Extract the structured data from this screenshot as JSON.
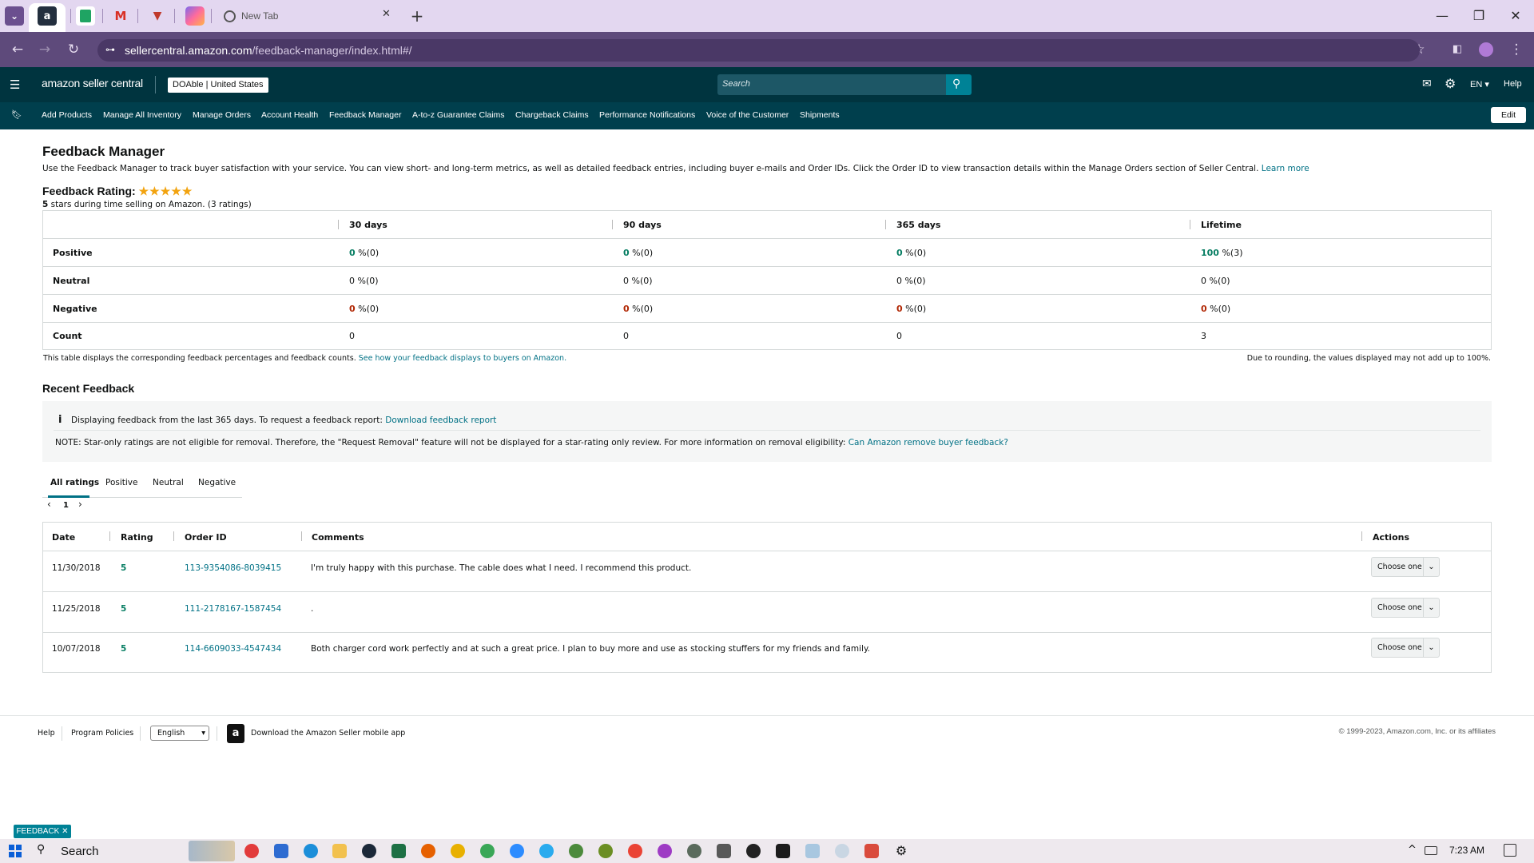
{
  "browser": {
    "tabs": [
      {
        "label": "",
        "icon": "amazon-icon"
      },
      {
        "label": "",
        "icon": "sheets-icon"
      },
      {
        "label": "",
        "icon": "gmail-icon"
      },
      {
        "label": "",
        "icon": "todoist-icon"
      },
      {
        "label": "",
        "icon": "clickup-icon"
      },
      {
        "label": "New Tab",
        "icon": "chrome-icon"
      }
    ],
    "url_host": "sellercentral.amazon.com",
    "url_path": "/feedback-manager/index.html#/"
  },
  "header": {
    "logo": "amazon seller central",
    "store": "DOAble",
    "marketplace": "United States",
    "search_placeholder": "Search",
    "language": "EN",
    "help": "Help"
  },
  "nav": {
    "items": [
      "Add Products",
      "Manage All Inventory",
      "Manage Orders",
      "Account Health",
      "Feedback Manager",
      "A-to-z Guarantee Claims",
      "Chargeback Claims",
      "Performance Notifications",
      "Voice of the Customer",
      "Shipments"
    ],
    "edit": "Edit"
  },
  "page": {
    "title": "Feedback Manager",
    "intro": "Use the Feedback Manager to track buyer satisfaction with your service. You can view short- and long-term metrics, as well as detailed feedback entries, including buyer e-mails and Order IDs. Click the Order ID to view transaction details within the Manage Orders section of Seller Central.",
    "learn_more": "Learn more",
    "rating_label": "Feedback Rating:",
    "rating_stars": 5,
    "rating_stars_max": 5,
    "rating_count_num": "5",
    "rating_summary": " stars during time selling on Amazon. (3 ratings)"
  },
  "summary_table": {
    "columns": [
      "30 days",
      "90 days",
      "365 days",
      "Lifetime"
    ],
    "rows": [
      {
        "label": "Positive",
        "cells": [
          {
            "v": "0",
            "u": " %(0)"
          },
          {
            "v": "0",
            "u": " %(0)"
          },
          {
            "v": "0",
            "u": " %(0)"
          },
          {
            "v": "100",
            "u": " %(3)"
          }
        ]
      },
      {
        "label": "Neutral",
        "cells": [
          {
            "v": "0",
            "u": " %(0)"
          },
          {
            "v": "0",
            "u": " %(0)"
          },
          {
            "v": "0",
            "u": " %(0)"
          },
          {
            "v": "0",
            "u": " %(0)"
          }
        ]
      },
      {
        "label": "Negative",
        "cells": [
          {
            "v": "0",
            "u": " %(0)"
          },
          {
            "v": "0",
            "u": " %(0)"
          },
          {
            "v": "0",
            "u": " %(0)"
          },
          {
            "v": "0",
            "u": " %(0)"
          }
        ]
      },
      {
        "label": "Count",
        "cells": [
          {
            "v": "0",
            "u": ""
          },
          {
            "v": "0",
            "u": ""
          },
          {
            "v": "0",
            "u": ""
          },
          {
            "v": "3",
            "u": ""
          }
        ]
      }
    ],
    "footnote": "This table displays the corresponding feedback percentages and feedback counts.",
    "footnote_link": "See how your feedback displays to buyers on Amazon.",
    "rounding_note": "Due to rounding, the values displayed may not add up to 100%."
  },
  "recent": {
    "title": "Recent Feedback",
    "info_text": "Displaying feedback from the last 365 days. To request a feedback report:",
    "info_link": "Download feedback report",
    "note_text": "NOTE: Star-only ratings are not eligible for removal. Therefore, the \"Request Removal\" feature will not be displayed for a star-rating only review. For more information on removal eligibility:",
    "note_link": "Can Amazon remove buyer feedback?",
    "tabs": [
      "All ratings",
      "Positive",
      "Neutral",
      "Negative"
    ],
    "page_number": "1",
    "columns": [
      "Date",
      "Rating",
      "Order ID",
      "Comments",
      "Actions"
    ],
    "rows": [
      {
        "date": "11/30/2018",
        "rating": "5",
        "order_id": "113-9354086-8039415",
        "comment": "I'm truly happy with this purchase. The cable does what I need. I recommend this product.",
        "action": "Choose one"
      },
      {
        "date": "11/25/2018",
        "rating": "5",
        "order_id": "111-2178167-1587454",
        "comment": ".",
        "action": "Choose one"
      },
      {
        "date": "10/07/2018",
        "rating": "5",
        "order_id": "114-6609033-4547434",
        "comment": "Both charger cord work perfectly and at such a great price. I plan to buy more and use as stocking stuffers for my friends and family.",
        "action": "Choose one"
      }
    ]
  },
  "footer": {
    "help": "Help",
    "policies": "Program Policies",
    "language": "English",
    "app": "Download the Amazon Seller mobile app",
    "copyright": "© 1999-2023, Amazon.com, Inc. or its affiliates"
  },
  "feedback_button": "FEEDBACK",
  "taskbar": {
    "search": "Search",
    "time": "7:23 AM"
  },
  "colors": {
    "header_bg": "#00343f",
    "nav_bg": "#003f4d",
    "link": "#007185",
    "positive": "#067d62",
    "negative": "#b12704",
    "browser_frame": "#5e4a7b"
  }
}
